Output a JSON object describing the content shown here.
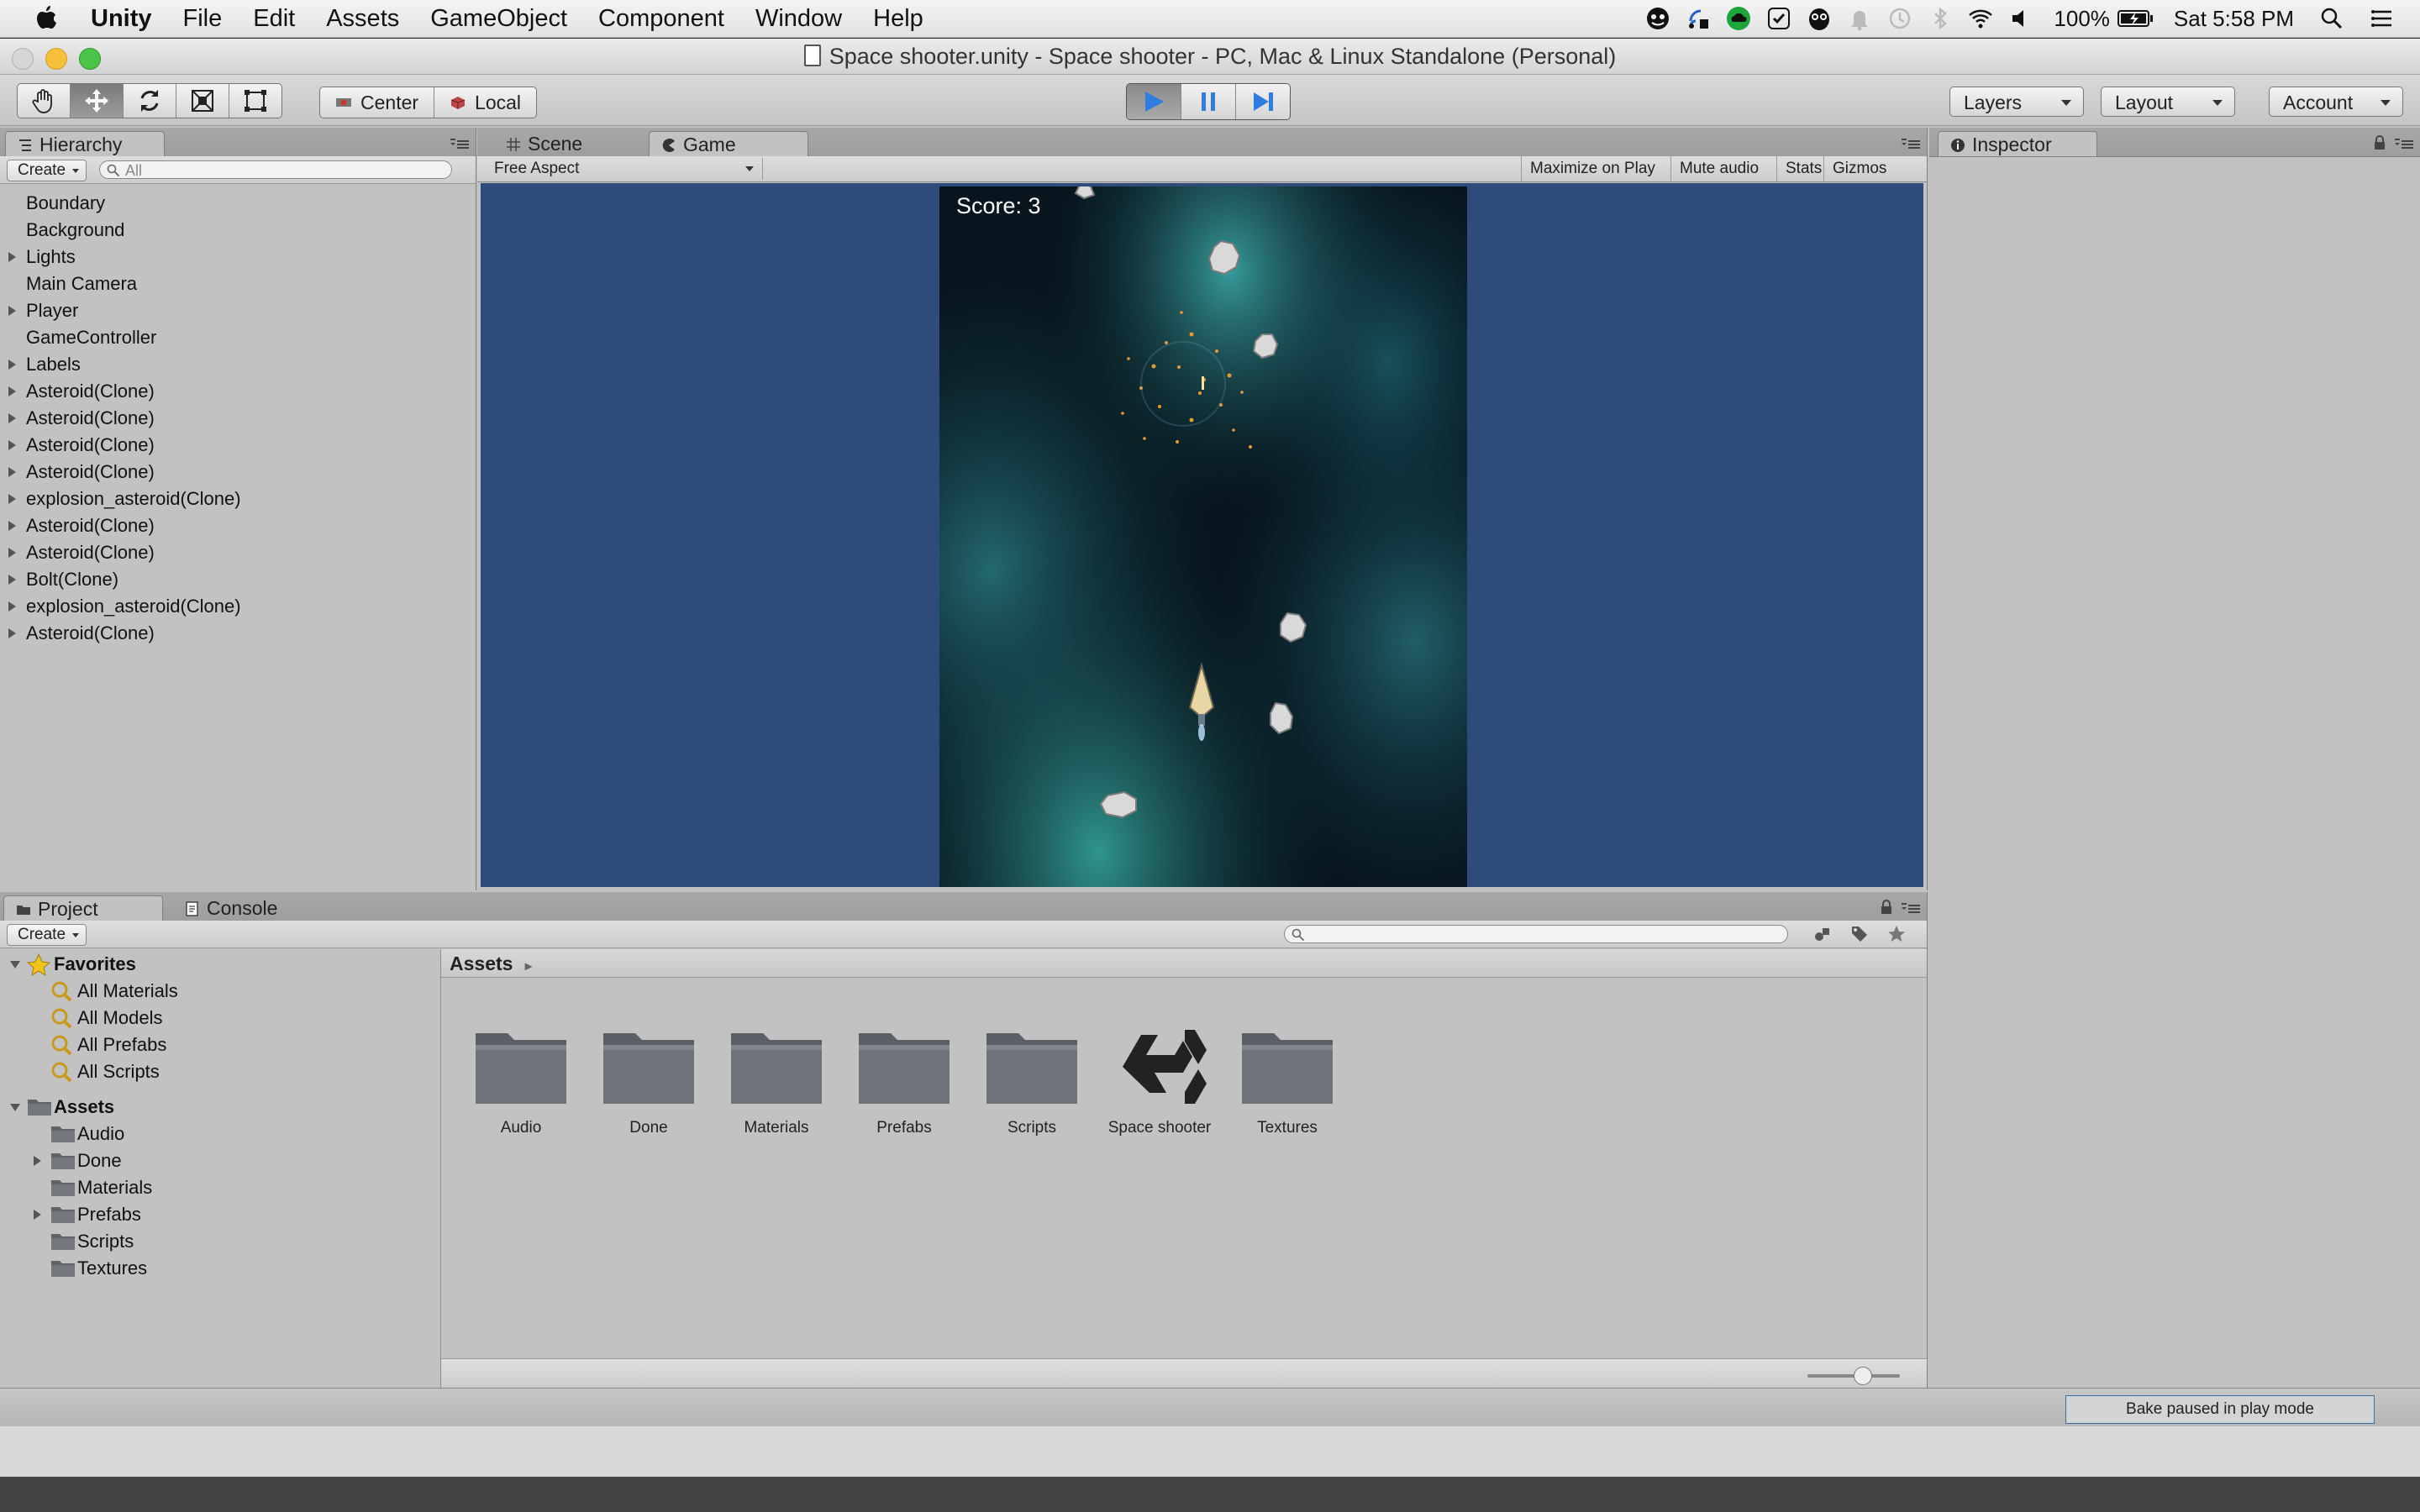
{
  "menubar": {
    "app_name": "Unity",
    "items": [
      "File",
      "Edit",
      "Assets",
      "GameObject",
      "Component",
      "Window",
      "Help"
    ],
    "battery": "100%",
    "clock": "Sat 5:58 PM"
  },
  "window": {
    "title": "Space shooter.unity - Space shooter - PC, Mac & Linux Standalone (Personal)"
  },
  "toolbar": {
    "tools": [
      "hand-tool",
      "move-tool",
      "rotate-tool",
      "scale-tool",
      "rect-tool"
    ],
    "pivot_center": "Center",
    "pivot_local": "Local",
    "layers_label": "Layers",
    "layout_label": "Layout",
    "account_label": "Account"
  },
  "hierarchy": {
    "tab_label": "Hierarchy",
    "create_label": "Create",
    "search_placeholder": "All",
    "items": [
      {
        "label": "Boundary",
        "expandable": false
      },
      {
        "label": "Background",
        "expandable": false
      },
      {
        "label": "Lights",
        "expandable": true
      },
      {
        "label": "Main Camera",
        "expandable": false
      },
      {
        "label": "Player",
        "expandable": true
      },
      {
        "label": "GameController",
        "expandable": false
      },
      {
        "label": "Labels",
        "expandable": true
      },
      {
        "label": "Asteroid(Clone)",
        "expandable": true
      },
      {
        "label": "Asteroid(Clone)",
        "expandable": true
      },
      {
        "label": "Asteroid(Clone)",
        "expandable": true
      },
      {
        "label": "Asteroid(Clone)",
        "expandable": true
      },
      {
        "label": "explosion_asteroid(Clone)",
        "expandable": true
      },
      {
        "label": "Asteroid(Clone)",
        "expandable": true
      },
      {
        "label": "Asteroid(Clone)",
        "expandable": true
      },
      {
        "label": "Bolt(Clone)",
        "expandable": true
      },
      {
        "label": "explosion_asteroid(Clone)",
        "expandable": true
      },
      {
        "label": "Asteroid(Clone)",
        "expandable": true
      }
    ]
  },
  "game_view": {
    "tab_scene": "Scene",
    "tab_game": "Game",
    "aspect": "Free Aspect",
    "maximize_on_play": "Maximize on Play",
    "mute_audio": "Mute audio",
    "stats": "Stats",
    "gizmos": "Gizmos",
    "score_text": "Score: 3"
  },
  "inspector": {
    "tab_label": "Inspector"
  },
  "project": {
    "tab_project": "Project",
    "tab_console": "Console",
    "create_label": "Create",
    "favorites_label": "Favorites",
    "favorites": [
      "All Materials",
      "All Models",
      "All Prefabs",
      "All Scripts"
    ],
    "assets_label": "Assets",
    "asset_folders": [
      {
        "label": "Audio",
        "expandable": false
      },
      {
        "label": "Done",
        "expandable": true
      },
      {
        "label": "Materials",
        "expandable": false
      },
      {
        "label": "Prefabs",
        "expandable": true
      },
      {
        "label": "Scripts",
        "expandable": false
      },
      {
        "label": "Textures",
        "expandable": false
      }
    ],
    "breadcrumb": "Assets",
    "grid_items": [
      {
        "label": "Audio",
        "kind": "folder"
      },
      {
        "label": "Done",
        "kind": "folder"
      },
      {
        "label": "Materials",
        "kind": "folder"
      },
      {
        "label": "Prefabs",
        "kind": "folder"
      },
      {
        "label": "Scripts",
        "kind": "folder"
      },
      {
        "label": "Space shooter",
        "kind": "unity-scene"
      },
      {
        "label": "Textures",
        "kind": "folder"
      }
    ]
  },
  "status": {
    "bake_text": "Bake paused in play mode"
  },
  "colors": {
    "game_bg": "#2f4b7c",
    "panel_bg": "#c2c2c2",
    "play_blue": "#2f7de1"
  }
}
